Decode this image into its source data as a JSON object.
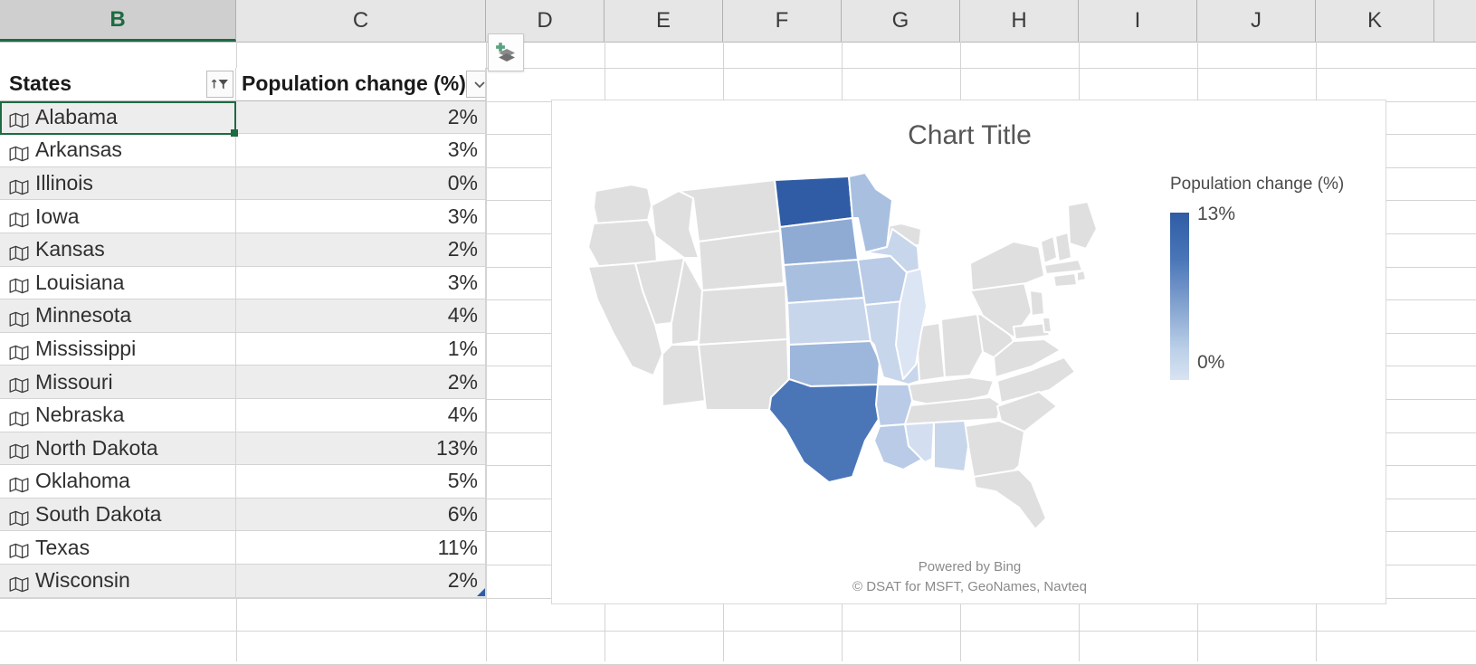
{
  "spreadsheet": {
    "column_headers": [
      "B",
      "C",
      "D",
      "E",
      "F",
      "G",
      "H",
      "I",
      "J",
      "K"
    ],
    "selected_column": "B",
    "active_cell_value": "Alabama",
    "quick_analysis_icon": "layers-plus-icon"
  },
  "table": {
    "headers": [
      "States",
      "Population change (%)"
    ],
    "states_filter_icon": "sort-ascending-filter-icon",
    "value_filter_icon": "filter-dropdown-icon",
    "row_icon": "map-geography-icon",
    "rows": [
      {
        "state": "Alabama",
        "change": "2%"
      },
      {
        "state": "Arkansas",
        "change": "3%"
      },
      {
        "state": "Illinois",
        "change": "0%"
      },
      {
        "state": "Iowa",
        "change": "3%"
      },
      {
        "state": "Kansas",
        "change": "2%"
      },
      {
        "state": "Louisiana",
        "change": "3%"
      },
      {
        "state": "Minnesota",
        "change": "4%"
      },
      {
        "state": "Mississippi",
        "change": "1%"
      },
      {
        "state": "Missouri",
        "change": "2%"
      },
      {
        "state": "Nebraska",
        "change": "4%"
      },
      {
        "state": "North Dakota",
        "change": "13%"
      },
      {
        "state": "Oklahoma",
        "change": "5%"
      },
      {
        "state": "South Dakota",
        "change": "6%"
      },
      {
        "state": "Texas",
        "change": "11%"
      },
      {
        "state": "Wisconsin",
        "change": "2%"
      }
    ]
  },
  "chart": {
    "title": "Chart Title",
    "legend_title": "Population change (%)",
    "legend_max": "13%",
    "legend_min": "0%",
    "attribution_line1": "Powered by Bing",
    "attribution_line2": "© DSAT for MSFT, GeoNames, Navteq"
  },
  "chart_data": {
    "type": "heatmap",
    "title": "Chart Title",
    "subtitle": "",
    "xlabel": "",
    "ylabel": "",
    "legend_label": "Population change (%)",
    "legend_position": "right",
    "value_range": [
      0,
      13
    ],
    "value_unit": "%",
    "color_min": "#D9E3F3",
    "color_max": "#2F5CA4",
    "color_nodata": "#DFDFDF",
    "categories": [
      "Alabama",
      "Arkansas",
      "Illinois",
      "Iowa",
      "Kansas",
      "Louisiana",
      "Minnesota",
      "Mississippi",
      "Missouri",
      "Nebraska",
      "North Dakota",
      "Oklahoma",
      "South Dakota",
      "Texas",
      "Wisconsin"
    ],
    "values": [
      2,
      3,
      0,
      3,
      2,
      3,
      4,
      1,
      2,
      4,
      13,
      5,
      6,
      11,
      2
    ],
    "series": [
      {
        "name": "Population change (%)",
        "points": [
          {
            "region": "Alabama",
            "value": 2,
            "fill": "#C8D6EC"
          },
          {
            "region": "Arkansas",
            "value": 3,
            "fill": "#B9CBE6"
          },
          {
            "region": "Illinois",
            "value": 0,
            "fill": "#DCE5F4"
          },
          {
            "region": "Iowa",
            "value": 3,
            "fill": "#B9CBE6"
          },
          {
            "region": "Kansas",
            "value": 2,
            "fill": "#C8D6EC"
          },
          {
            "region": "Louisiana",
            "value": 3,
            "fill": "#B9CBE6"
          },
          {
            "region": "Minnesota",
            "value": 4,
            "fill": "#A8BFE0"
          },
          {
            "region": "Mississippi",
            "value": 1,
            "fill": "#D3DFF1"
          },
          {
            "region": "Missouri",
            "value": 2,
            "fill": "#C8D6EC"
          },
          {
            "region": "Nebraska",
            "value": 4,
            "fill": "#A8BFE0"
          },
          {
            "region": "North Dakota",
            "value": 13,
            "fill": "#2F5CA4"
          },
          {
            "region": "Oklahoma",
            "value": 5,
            "fill": "#9DB6DB"
          },
          {
            "region": "South Dakota",
            "value": 6,
            "fill": "#8FABD4"
          },
          {
            "region": "Texas",
            "value": 11,
            "fill": "#4A76B8"
          },
          {
            "region": "Wisconsin",
            "value": 2,
            "fill": "#C8D6EC"
          }
        ]
      }
    ],
    "no_data_regions": [
      "Washington",
      "Oregon",
      "California",
      "Nevada",
      "Idaho",
      "Montana",
      "Wyoming",
      "Utah",
      "Arizona",
      "Colorado",
      "New Mexico",
      "Michigan",
      "Indiana",
      "Ohio",
      "Kentucky",
      "Tennessee",
      "Georgia",
      "Florida",
      "South Carolina",
      "North Carolina",
      "Virginia",
      "West Virginia",
      "Pennsylvania",
      "New York",
      "Maine",
      "Vermont",
      "New Hampshire",
      "Massachusetts",
      "Rhode Island",
      "Connecticut",
      "New Jersey",
      "Delaware",
      "Maryland"
    ],
    "grid": false
  }
}
